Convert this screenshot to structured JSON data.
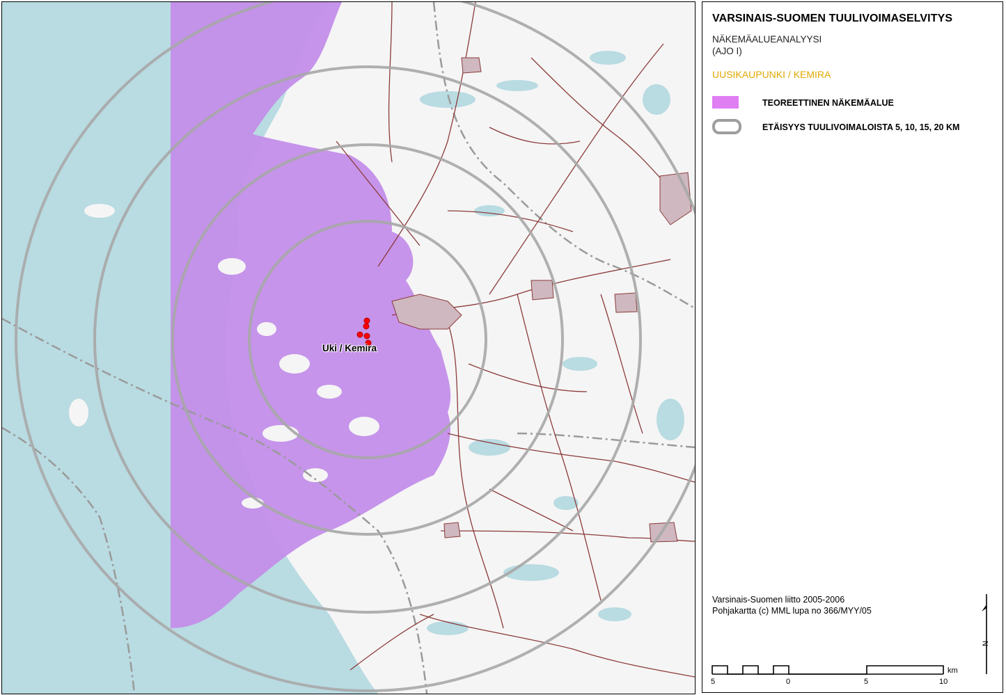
{
  "legend": {
    "title": "VARSINAIS-SUOMEN TUULIVOIMASELVITYS",
    "subtitle_line1": "NÄKEMÄALUEANALYYSI",
    "subtitle_line2": "(AJO I)",
    "area_title": "UUSIKAUPUNKI / KEMIRA",
    "items": [
      {
        "label": "TEOREETTINEN NÄKEMÄALUE",
        "symbol": "fill",
        "color": "#e07ef4"
      },
      {
        "label": "ETÄISYYS TUULIVOIMALOISTA 5, 10, 15, 20 KM",
        "symbol": "ring",
        "color": "#9e9e9e"
      }
    ],
    "credits_line1": "Varsinais-Suomen liitto 2005-2006",
    "credits_line2": "Pohjakartta (c) MML lupa no 366/MYY/05",
    "north_label": "N"
  },
  "map": {
    "site_label": "Uki / Kemira",
    "colors": {
      "sea": "#b9dbe2",
      "land": "#f5f5f5",
      "visibility": "#c38ee9",
      "roads": "#8b3a3a",
      "rings": "#a8a8a8",
      "turbines": "#ff0000",
      "boundaries": "#9a9a9a"
    }
  },
  "scalebar": {
    "unit": "km",
    "ticks": [
      "5",
      "0",
      "5",
      "10"
    ]
  }
}
